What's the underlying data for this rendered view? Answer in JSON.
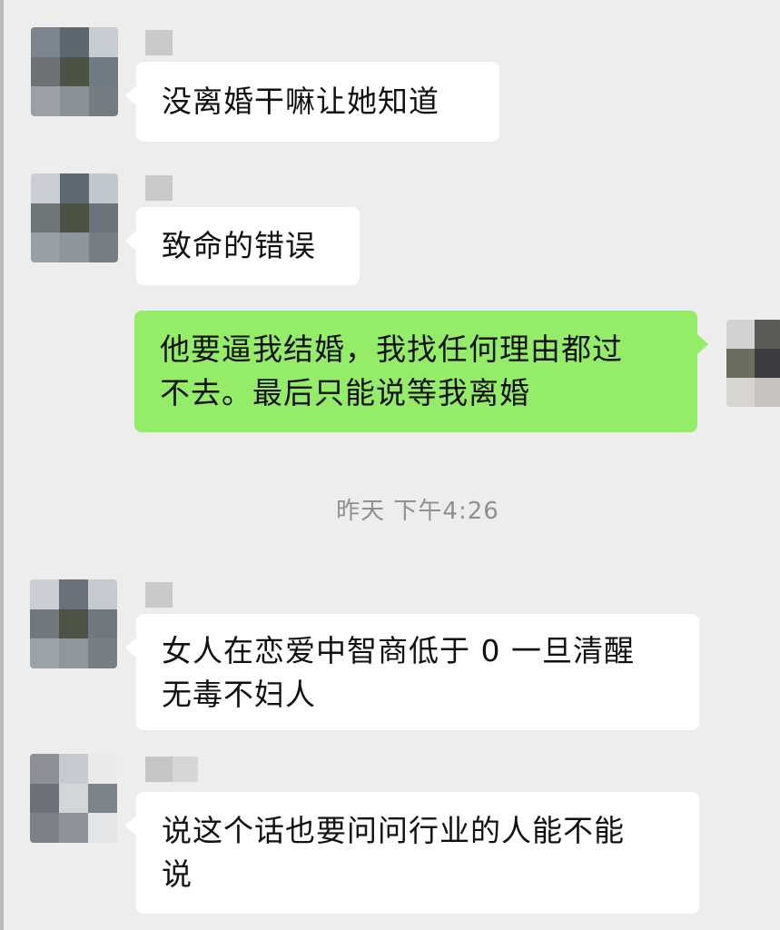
{
  "chat": {
    "messages": [
      {
        "side": "left",
        "lines": [
          "没离婚干嘛让她知道"
        ]
      },
      {
        "side": "left",
        "lines": [
          "致命的错误"
        ]
      },
      {
        "side": "right",
        "lines": [
          "他要逼我结婚，我找任何理由都过",
          "不去。最后只能说等我离婚"
        ]
      },
      {
        "side": "left",
        "lines": [
          "女人在恋爱中智商低于 0 一旦清醒",
          "无毒不妇人"
        ]
      },
      {
        "side": "left",
        "lines": [
          "说这个话也要问问行业的人能不能",
          "说"
        ]
      }
    ],
    "timestamp": "昨天 下午4:26"
  },
  "colors": {
    "background": "#ededed",
    "incoming_bubble": "#ffffff",
    "outgoing_bubble": "#95ec69",
    "timestamp_text": "#8f8f8f"
  }
}
